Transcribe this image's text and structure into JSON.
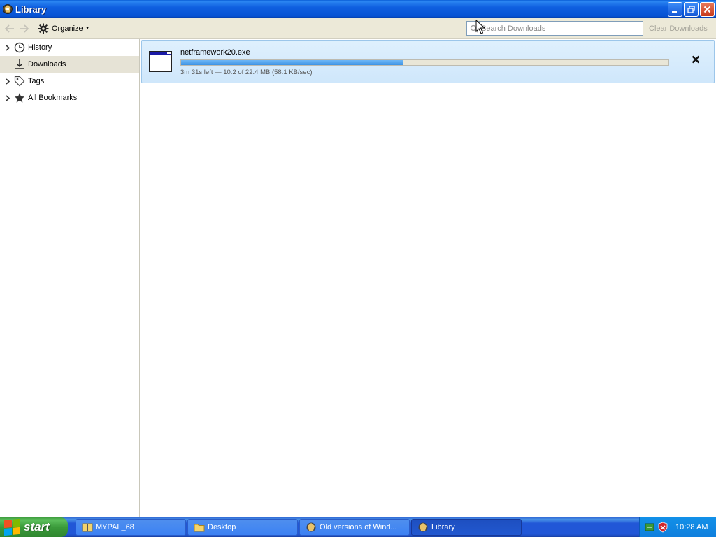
{
  "window": {
    "title": "Library"
  },
  "toolbar": {
    "organize_label": "Organize",
    "search_placeholder": "Search Downloads",
    "clear_label": "Clear Downloads"
  },
  "sidebar": {
    "items": [
      {
        "label": "History",
        "icon": "clock-icon",
        "expandable": true,
        "selected": false
      },
      {
        "label": "Downloads",
        "icon": "download-arrow-icon",
        "expandable": false,
        "selected": true
      },
      {
        "label": "Tags",
        "icon": "tag-icon",
        "expandable": true,
        "selected": false
      },
      {
        "label": "All Bookmarks",
        "icon": "star-icon",
        "expandable": true,
        "selected": false
      }
    ]
  },
  "downloads": [
    {
      "file_name": "netframework20.exe",
      "status": "3m 31s left — 10.2 of 22.4 MB (58.1 KB/sec)",
      "progress_fraction": 0.455
    }
  ],
  "taskbar": {
    "start_label": "start",
    "tasks": [
      {
        "label": "MYPAL_68",
        "active": false
      },
      {
        "label": "Desktop",
        "active": false
      },
      {
        "label": "Old versions of Wind...",
        "active": false
      },
      {
        "label": "Library",
        "active": true
      }
    ],
    "clock": "10:28 AM"
  },
  "colors": {
    "titlebar": "#0753d4",
    "progress": "#3f94e4",
    "selected_row": "#e6e3d6",
    "taskbar": "#2157d7",
    "start_button": "#3a9a3a"
  }
}
